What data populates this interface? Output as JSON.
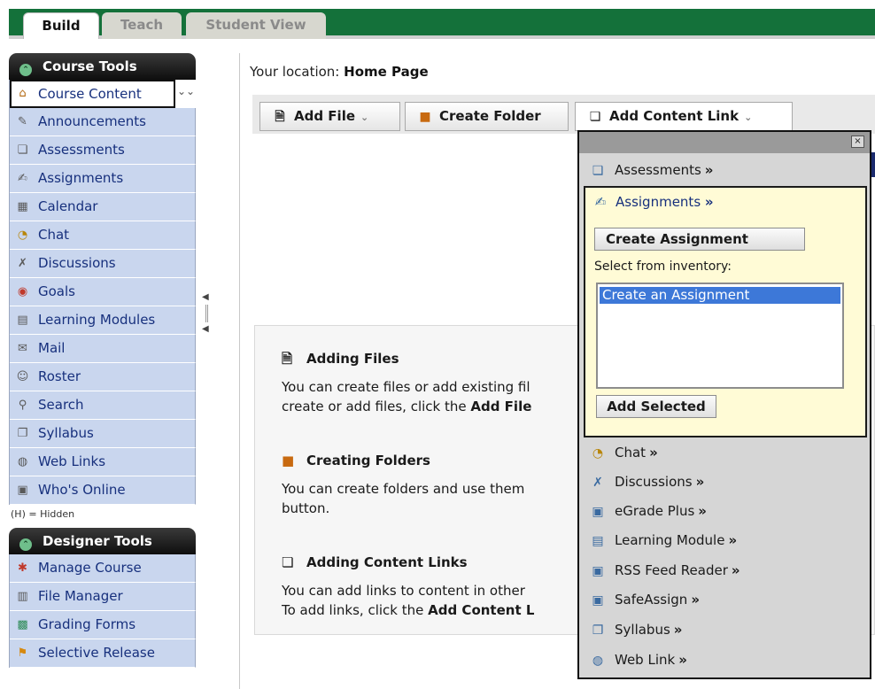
{
  "tabs": {
    "build": "Build",
    "teach": "Teach",
    "student_view": "Student View"
  },
  "course_tools": {
    "heading": "Course Tools",
    "items": [
      {
        "label": "Course Content",
        "icon": "course-content-icon"
      },
      {
        "label": "Announcements",
        "icon": "announcements-icon"
      },
      {
        "label": "Assessments",
        "icon": "assessments-icon"
      },
      {
        "label": "Assignments",
        "icon": "assignments-icon"
      },
      {
        "label": "Calendar",
        "icon": "calendar-icon"
      },
      {
        "label": "Chat",
        "icon": "chat-icon"
      },
      {
        "label": "Discussions",
        "icon": "discussions-icon"
      },
      {
        "label": "Goals",
        "icon": "goals-icon"
      },
      {
        "label": "Learning Modules",
        "icon": "learning-modules-icon"
      },
      {
        "label": "Mail",
        "icon": "mail-icon"
      },
      {
        "label": "Roster",
        "icon": "roster-icon"
      },
      {
        "label": "Search",
        "icon": "search-icon"
      },
      {
        "label": "Syllabus",
        "icon": "syllabus-icon"
      },
      {
        "label": "Web Links",
        "icon": "web-links-icon"
      },
      {
        "label": "Who's Online",
        "icon": "whos-online-icon"
      }
    ],
    "hidden_note": "(H) = Hidden"
  },
  "designer_tools": {
    "heading": "Designer Tools",
    "items": [
      {
        "label": "Manage Course",
        "icon": "manage-course-icon"
      },
      {
        "label": "File Manager",
        "icon": "file-manager-icon"
      },
      {
        "label": "Grading Forms",
        "icon": "grading-forms-icon"
      },
      {
        "label": "Selective Release",
        "icon": "selective-release-icon"
      }
    ]
  },
  "location": {
    "prefix": "Your location:",
    "page": "Home Page"
  },
  "toolbar": {
    "add_file": "Add File",
    "create_folder": "Create Folder",
    "add_content_link": "Add Content Link"
  },
  "help": {
    "files_title": "Adding Files",
    "files_line1": "You can create files or add existing fil",
    "files_line2_pre": "create or add files, click the ",
    "files_line2_bold": "Add File",
    "folders_title": "Creating Folders",
    "folders_line1": "You can create folders and use them",
    "folders_line2": "button.",
    "links_title": "Adding Content Links",
    "links_line1": "You can add links to content in other",
    "links_line2_pre": "To add links, click the ",
    "links_line2_bold": "Add Content L"
  },
  "content_link_menu": {
    "close": "×",
    "items_before": [
      {
        "label": "Assessments",
        "chevron": "»",
        "icon": "assessments-icon"
      }
    ],
    "assignments": {
      "label": "Assignments",
      "chevron": "»",
      "create_button": "Create Assignment",
      "inventory_label": "Select from inventory:",
      "inventory_options": [
        "Create an Assignment"
      ],
      "add_selected_button": "Add Selected"
    },
    "items_after": [
      {
        "label": "Chat",
        "chevron": "»",
        "icon": "chat-icon"
      },
      {
        "label": "Discussions",
        "chevron": "»",
        "icon": "discussions-icon"
      },
      {
        "label": "eGrade Plus",
        "chevron": "»",
        "icon": "egrade-plus-icon"
      },
      {
        "label": "Learning Module",
        "chevron": "»",
        "icon": "learning-module-icon"
      },
      {
        "label": "RSS Feed Reader",
        "chevron": "»",
        "icon": "rss-feed-reader-icon"
      },
      {
        "label": "SafeAssign",
        "chevron": "»",
        "icon": "safeassign-icon"
      },
      {
        "label": "Syllabus",
        "chevron": "»",
        "icon": "syllabus-icon"
      },
      {
        "label": "Web Link",
        "chevron": "»",
        "icon": "web-link-icon"
      }
    ]
  }
}
